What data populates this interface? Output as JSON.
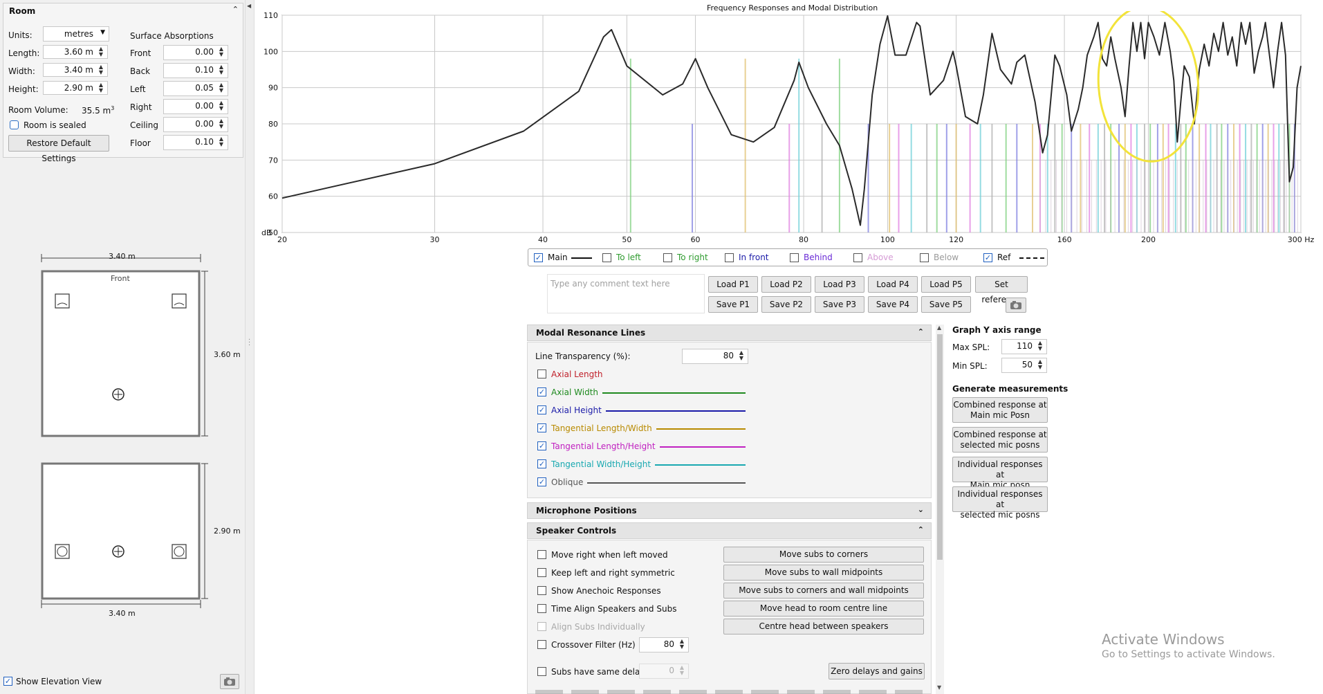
{
  "room": {
    "title": "Room",
    "units_label": "Units:",
    "units_value": "metres",
    "length_label": "Length:",
    "length_value": "3.60 m",
    "width_label": "Width:",
    "width_value": "3.40 m",
    "height_label": "Height:",
    "height_value": "2.90 m",
    "volume_label": "Room Volume:",
    "volume_value": "35.5 m",
    "volume_sup": "3",
    "sealed_label": "Room is sealed",
    "restore_label": "Restore Default Settings",
    "absorptions_title": "Surface Absorptions",
    "absorptions": [
      {
        "label": "Front",
        "value": "0.00"
      },
      {
        "label": "Back",
        "value": "0.10"
      },
      {
        "label": "Left",
        "value": "0.05"
      },
      {
        "label": "Right",
        "value": "0.00"
      },
      {
        "label": "Ceiling",
        "value": "0.00"
      },
      {
        "label": "Floor",
        "value": "0.10"
      }
    ]
  },
  "plan": {
    "top_width": "3.40 m",
    "front_label": "Front",
    "depth": "3.60 m",
    "elev_height": "2.90 m",
    "elev_width": "3.40 m"
  },
  "left_footer": {
    "elevation_label": "Show Elevation View"
  },
  "graph": {
    "title": "Frequency Responses and Modal Distribution",
    "y_unit": "dB",
    "y_ticks": [
      "110",
      "100",
      "90",
      "80",
      "70",
      "60",
      "50"
    ],
    "x_ticks": [
      "20",
      "30",
      "40",
      "50",
      "60",
      "80",
      "100",
      "120",
      "160",
      "200",
      "300 Hz"
    ]
  },
  "legend": {
    "items": [
      {
        "label": "Main",
        "checked": true,
        "color": "#111111"
      },
      {
        "label": "To left",
        "checked": false,
        "color": "#2e9b2e"
      },
      {
        "label": "To right",
        "checked": false,
        "color": "#2e9b2e"
      },
      {
        "label": "In front",
        "checked": false,
        "color": "#1a1aa8"
      },
      {
        "label": "Behind",
        "checked": false,
        "color": "#7a3d00"
      },
      {
        "label": "Above",
        "checked": false,
        "color": "#d070d0"
      },
      {
        "label": "Below",
        "checked": false,
        "color": "#888888"
      },
      {
        "label": "Ref",
        "checked": true,
        "color": "#111111"
      }
    ]
  },
  "presets": {
    "comment_placeholder": "Type any comment text here",
    "load": [
      "Load P1",
      "Load P2",
      "Load P3",
      "Load P4",
      "Load P5"
    ],
    "save": [
      "Save P1",
      "Save P2",
      "Save P3",
      "Save P4",
      "Save P5"
    ],
    "set_reference": "Set reference"
  },
  "modal": {
    "title": "Modal Resonance Lines",
    "transparency_label": "Line Transparency (%):",
    "transparency_value": "80",
    "lines": [
      {
        "label": "Axial Length",
        "checked": false,
        "color": "#c0202a"
      },
      {
        "label": "Axial Width",
        "checked": true,
        "color": "#1f8a1f"
      },
      {
        "label": "Axial Height",
        "checked": true,
        "color": "#1a1aa8"
      },
      {
        "label": "Tangential Length/Width",
        "checked": true,
        "color": "#b88a00"
      },
      {
        "label": "Tangential Length/Height",
        "checked": true,
        "color": "#c020c0"
      },
      {
        "label": "Tangential Width/Height",
        "checked": true,
        "color": "#18a8b0"
      },
      {
        "label": "Oblique",
        "checked": true,
        "color": "#555555"
      }
    ]
  },
  "mic_positions": {
    "title": "Microphone Positions"
  },
  "speaker": {
    "title": "Speaker Controls",
    "options": [
      {
        "label": "Move right when left moved",
        "disabled": false
      },
      {
        "label": "Keep left and right symmetric",
        "disabled": false
      },
      {
        "label": "Show Anechoic Responses",
        "disabled": false
      },
      {
        "label": "Time Align Speakers and Subs",
        "disabled": false
      },
      {
        "label": "Align Subs Individually",
        "disabled": true
      },
      {
        "label": "Crossover Filter (Hz)",
        "disabled": false
      },
      {
        "label": "Subs have same delay",
        "disabled": false
      }
    ],
    "crossover_value": "80",
    "subs_delay_value": "0",
    "buttons": [
      "Move subs to corners",
      "Move subs to wall midpoints",
      "Move subs to corners and wall midpoints",
      "Move head to room centre line",
      "Centre head between speakers"
    ],
    "zero_label": "Zero delays and gains"
  },
  "yaxis": {
    "title": "Graph Y axis range",
    "max_label": "Max SPL:",
    "max_value": "110",
    "min_label": "Min SPL:",
    "min_value": "50"
  },
  "generate": {
    "title": "Generate measurements",
    "buttons": [
      {
        "line1": "Combined response at",
        "line2": "Main mic Posn"
      },
      {
        "line1": "Combined response at",
        "line2": "selected mic posns"
      },
      {
        "line1": "Individual responses at",
        "line2": "Main mic posn"
      },
      {
        "line1": "Individual responses at",
        "line2": "selected mic posns"
      }
    ]
  },
  "watermark": {
    "title": "Activate Windows",
    "subtitle": "Go to Settings to activate Windows."
  }
}
